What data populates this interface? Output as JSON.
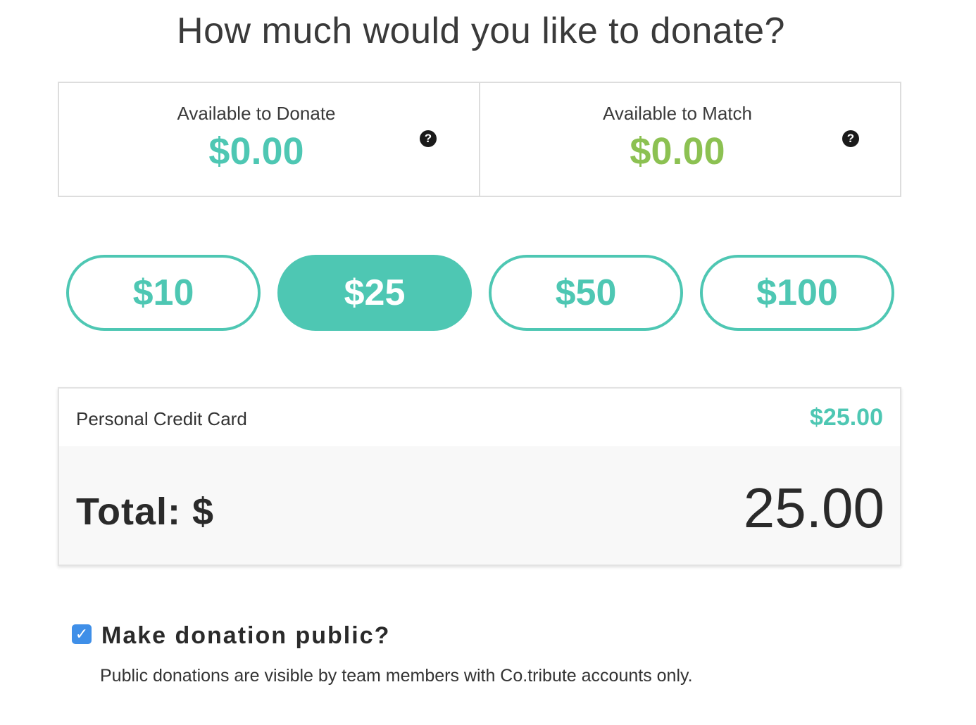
{
  "header": {
    "title": "How much would you like to donate?"
  },
  "balances": {
    "donate": {
      "label": "Available to Donate",
      "amount": "$0.00",
      "color": "#4ec7b3",
      "help_icon": "question-circle-icon",
      "help_glyph": "?"
    },
    "match": {
      "label": "Available to Match",
      "amount": "$0.00",
      "color": "#8cc152",
      "help_icon": "question-circle-icon",
      "help_glyph": "?"
    }
  },
  "amount_options": [
    {
      "label": "$10",
      "selected": false
    },
    {
      "label": "$25",
      "selected": true
    },
    {
      "label": "$50",
      "selected": false
    },
    {
      "label": "$100",
      "selected": false
    }
  ],
  "payment": {
    "method": "Personal Credit Card",
    "amount": "$25.00",
    "total_label": "Total: $",
    "total_value": "25.00"
  },
  "public_option": {
    "checked": true,
    "check_glyph": "✓",
    "label": "Make donation public?",
    "note": "Public donations are visible by team members with Co.tribute accounts only."
  },
  "colors": {
    "accent": "#4ec7b3",
    "match_green": "#8cc152",
    "checkbox_blue": "#3f8fe8"
  }
}
